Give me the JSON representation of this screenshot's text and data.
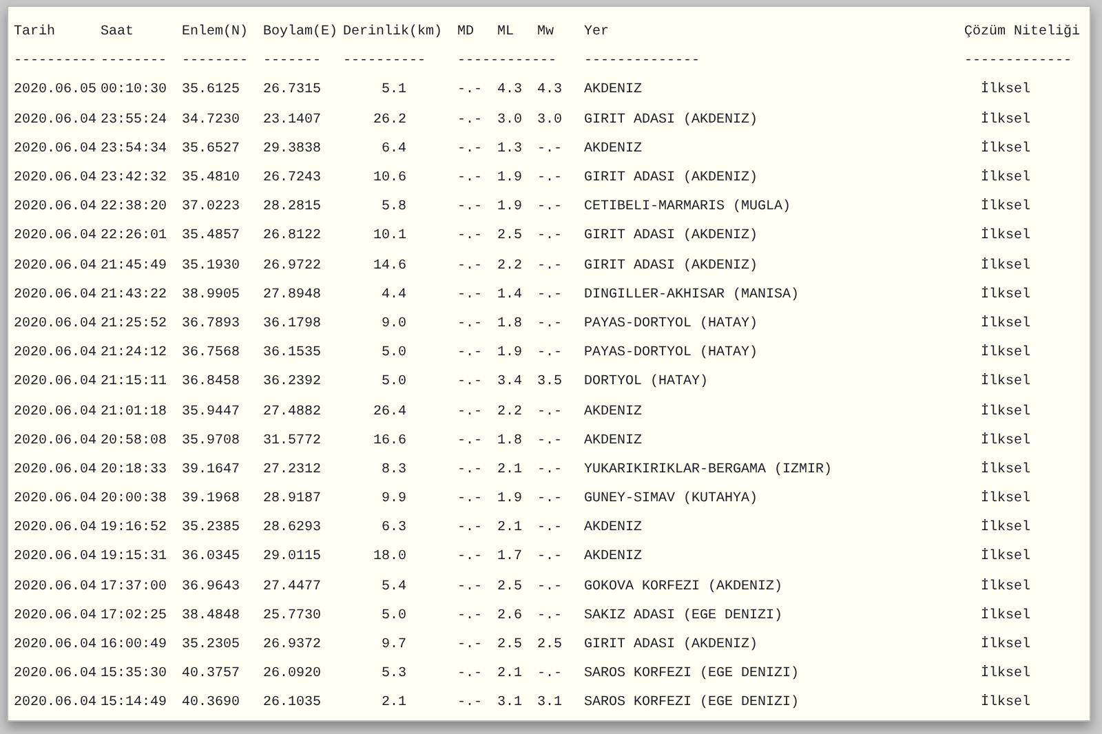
{
  "table": {
    "columns": [
      "Tarih",
      "Saat",
      "Enlem(N)",
      "Boylam(E)",
      "Derinlik(km)",
      "MD",
      "ML",
      "Mw",
      "Yer",
      "Çözüm Niteliği"
    ],
    "separators": [
      "----------",
      "--------",
      "--------",
      "-------",
      "----------",
      "------------",
      "--------------",
      "-------------"
    ],
    "rows": [
      [
        "2020.06.05",
        "00:10:30",
        "35.6125",
        "26.7315",
        "5.1",
        "-.-",
        "4.3",
        "4.3",
        "AKDENIZ",
        "İlksel"
      ],
      [
        "2020.06.04",
        "23:55:24",
        "34.7230",
        "23.1407",
        "26.2",
        "-.-",
        "3.0",
        "3.0",
        "GIRIT ADASI (AKDENIZ)",
        "İlksel"
      ],
      [
        "2020.06.04",
        "23:54:34",
        "35.6527",
        "29.3838",
        "6.4",
        "-.-",
        "1.3",
        "-.-",
        "AKDENIZ",
        "İlksel"
      ],
      [
        "2020.06.04",
        "23:42:32",
        "35.4810",
        "26.7243",
        "10.6",
        "-.-",
        "1.9",
        "-.-",
        "GIRIT ADASI (AKDENIZ)",
        "İlksel"
      ],
      [
        "2020.06.04",
        "22:38:20",
        "37.0223",
        "28.2815",
        "5.8",
        "-.-",
        "1.9",
        "-.-",
        "CETIBELI-MARMARIS (MUGLA)",
        "İlksel"
      ],
      [
        "2020.06.04",
        "22:26:01",
        "35.4857",
        "26.8122",
        "10.1",
        "-.-",
        "2.5",
        "-.-",
        "GIRIT ADASI (AKDENIZ)",
        "İlksel"
      ],
      [
        "2020.06.04",
        "21:45:49",
        "35.1930",
        "26.9722",
        "14.6",
        "-.-",
        "2.2",
        "-.-",
        "GIRIT ADASI (AKDENIZ)",
        "İlksel"
      ],
      [
        "2020.06.04",
        "21:43:22",
        "38.9905",
        "27.8948",
        "4.4",
        "-.-",
        "1.4",
        "-.-",
        "DINGILLER-AKHISAR (MANISA)",
        "İlksel"
      ],
      [
        "2020.06.04",
        "21:25:52",
        "36.7893",
        "36.1798",
        "9.0",
        "-.-",
        "1.8",
        "-.-",
        "PAYAS-DORTYOL (HATAY)",
        "İlksel"
      ],
      [
        "2020.06.04",
        "21:24:12",
        "36.7568",
        "36.1535",
        "5.0",
        "-.-",
        "1.9",
        "-.-",
        "PAYAS-DORTYOL (HATAY)",
        "İlksel"
      ],
      [
        "2020.06.04",
        "21:15:11",
        "36.8458",
        "36.2392",
        "5.0",
        "-.-",
        "3.4",
        "3.5",
        "DORTYOL (HATAY)",
        "İlksel"
      ],
      [
        "2020.06.04",
        "21:01:18",
        "35.9447",
        "27.4882",
        "26.4",
        "-.-",
        "2.2",
        "-.-",
        "AKDENIZ",
        "İlksel"
      ],
      [
        "2020.06.04",
        "20:58:08",
        "35.9708",
        "31.5772",
        "16.6",
        "-.-",
        "1.8",
        "-.-",
        "AKDENIZ",
        "İlksel"
      ],
      [
        "2020.06.04",
        "20:18:33",
        "39.1647",
        "27.2312",
        "8.3",
        "-.-",
        "2.1",
        "-.-",
        "YUKARIKIRIKLAR-BERGAMA (IZMIR)",
        "İlksel"
      ],
      [
        "2020.06.04",
        "20:00:38",
        "39.1968",
        "28.9187",
        "9.9",
        "-.-",
        "1.9",
        "-.-",
        "GUNEY-SIMAV (KUTAHYA)",
        "İlksel"
      ],
      [
        "2020.06.04",
        "19:16:52",
        "35.2385",
        "28.6293",
        "6.3",
        "-.-",
        "2.1",
        "-.-",
        "AKDENIZ",
        "İlksel"
      ],
      [
        "2020.06.04",
        "19:15:31",
        "36.0345",
        "29.0115",
        "18.0",
        "-.-",
        "1.7",
        "-.-",
        "AKDENIZ",
        "İlksel"
      ],
      [
        "2020.06.04",
        "17:37:00",
        "36.9643",
        "27.4477",
        "5.4",
        "-.-",
        "2.5",
        "-.-",
        "GOKOVA KORFEZI (AKDENIZ)",
        "İlksel"
      ],
      [
        "2020.06.04",
        "17:02:25",
        "38.4848",
        "25.7730",
        "5.0",
        "-.-",
        "2.6",
        "-.-",
        "SAKIZ ADASI (EGE DENIZI)",
        "İlksel"
      ],
      [
        "2020.06.04",
        "16:00:49",
        "35.2305",
        "26.9372",
        "9.7",
        "-.-",
        "2.5",
        "2.5",
        "GIRIT ADASI (AKDENIZ)",
        "İlksel"
      ],
      [
        "2020.06.04",
        "15:35:30",
        "40.3757",
        "26.0920",
        "5.3",
        "-.-",
        "2.1",
        "-.-",
        "SAROS KORFEZI (EGE DENIZI)",
        "İlksel"
      ],
      [
        "2020.06.04",
        "15:14:49",
        "40.3690",
        "26.1035",
        "2.1",
        "-.-",
        "3.1",
        "3.1",
        "SAROS KORFEZI (EGE DENIZI)",
        "İlksel"
      ]
    ]
  }
}
